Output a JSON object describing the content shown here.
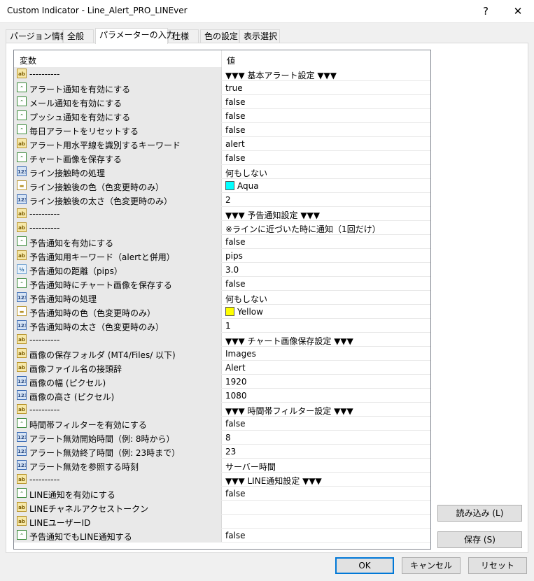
{
  "window": {
    "title": "Custom Indicator - Line_Alert_PRO_LINEver",
    "help": "?",
    "close": "✕"
  },
  "tabs": [
    {
      "label": "パージョン情報"
    },
    {
      "label": "全般"
    },
    {
      "label": "パラメーターの入力"
    },
    {
      "label": "仕様"
    },
    {
      "label": "色の設定"
    },
    {
      "label": "表示選択"
    }
  ],
  "grid": {
    "col_variable": "変数",
    "col_value": "値",
    "rows": [
      {
        "icon": "ab",
        "name": "----------",
        "value": "▼▼▼ 基本アラート設定 ▼▼▼"
      },
      {
        "icon": "bool",
        "name": "アラート通知を有効にする",
        "value": "true"
      },
      {
        "icon": "bool",
        "name": "メール通知を有効にする",
        "value": "false"
      },
      {
        "icon": "bool",
        "name": "プッシュ通知を有効にする",
        "value": "false"
      },
      {
        "icon": "bool",
        "name": "毎日アラートをリセットする",
        "value": "false"
      },
      {
        "icon": "ab",
        "name": "アラート用水平線を識別するキーワード",
        "value": "alert"
      },
      {
        "icon": "bool",
        "name": "チャート画像を保存する",
        "value": "false"
      },
      {
        "icon": "int",
        "name": "ライン接触時の処理",
        "value": "何もしない"
      },
      {
        "icon": "col",
        "name": "ライン接触後の色（色変更時のみ）",
        "value": "Aqua",
        "swatch": "#00ffff"
      },
      {
        "icon": "int",
        "name": "ライン接触後の太さ（色変更時のみ）",
        "value": "2"
      },
      {
        "icon": "ab",
        "name": "----------",
        "value": "▼▼▼ 予告通知設定 ▼▼▼"
      },
      {
        "icon": "ab",
        "name": "----------",
        "value": "※ラインに近づいた時に通知（1回だけ）"
      },
      {
        "icon": "bool",
        "name": "予告通知を有効にする",
        "value": "false"
      },
      {
        "icon": "ab",
        "name": "予告通知用キーワード（alertと併用）",
        "value": "pips"
      },
      {
        "icon": "dbl",
        "name": "予告通知の距離（pips）",
        "value": "3.0"
      },
      {
        "icon": "bool",
        "name": "予告通知時にチャート画像を保存する",
        "value": "false"
      },
      {
        "icon": "int",
        "name": "予告通知時の処理",
        "value": "何もしない"
      },
      {
        "icon": "col",
        "name": "予告通知時の色（色変更時のみ）",
        "value": "Yellow",
        "swatch": "#ffff00"
      },
      {
        "icon": "int",
        "name": "予告通知時の太さ（色変更時のみ）",
        "value": "1"
      },
      {
        "icon": "ab",
        "name": "----------",
        "value": "▼▼▼ チャート画像保存設定 ▼▼▼"
      },
      {
        "icon": "ab",
        "name": "画像の保存フォルダ (MT4/Files/ 以下)",
        "value": "Images"
      },
      {
        "icon": "ab",
        "name": "画像ファイル名の接頭辞",
        "value": "Alert"
      },
      {
        "icon": "int",
        "name": "画像の幅 (ピクセル)",
        "value": "1920"
      },
      {
        "icon": "int",
        "name": "画像の高さ (ピクセル)",
        "value": "1080"
      },
      {
        "icon": "ab",
        "name": "----------",
        "value": "▼▼▼ 時間帯フィルター設定 ▼▼▼"
      },
      {
        "icon": "bool",
        "name": "時間帯フィルターを有効にする",
        "value": "false"
      },
      {
        "icon": "int",
        "name": "アラート無効開始時間（例: 8時から）",
        "value": "8"
      },
      {
        "icon": "int",
        "name": "アラート無効終了時間（例: 23時まで）",
        "value": "23"
      },
      {
        "icon": "int",
        "name": "アラート無効を参照する時刻",
        "value": "サーバー時間"
      },
      {
        "icon": "ab",
        "name": "----------",
        "value": "▼▼▼ LINE通知設定 ▼▼▼"
      },
      {
        "icon": "bool",
        "name": "LINE通知を有効にする",
        "value": "false"
      },
      {
        "icon": "ab",
        "name": "LINEチャネルアクセストークン",
        "value": ""
      },
      {
        "icon": "ab",
        "name": "LINEユーザーID",
        "value": ""
      },
      {
        "icon": "bool",
        "name": "予告通知でもLINE通知する",
        "value": "false"
      }
    ]
  },
  "buttons": {
    "load": "読み込み (L)",
    "save": "保存 (S)",
    "ok": "OK",
    "cancel": "キャンセル",
    "reset": "リセット"
  }
}
